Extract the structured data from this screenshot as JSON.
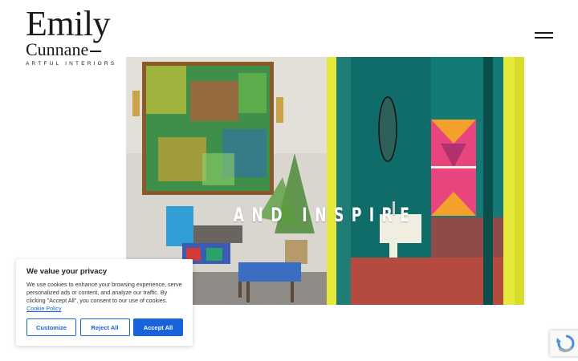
{
  "logo": {
    "line1": "Emily",
    "line2": "Cunnane",
    "tagline": "ARTFUL INTERIORS"
  },
  "menu": {
    "icon": "hamburger-menu-icon"
  },
  "hero": {
    "overlay_text": "AND INSPIRE"
  },
  "cookie_banner": {
    "title": "We value your privacy",
    "body": "We use cookies to enhance your browsing experience, serve personalized ads or content, and analyze our traffic. By clicking \"Accept All\", you consent to our use of cookies.",
    "policy_link": "Cookie Policy",
    "buttons": {
      "customize": "Customize",
      "reject": "Reject All",
      "accept": "Accept All"
    },
    "accent": "#1863dc"
  },
  "recaptcha": {
    "icon": "recaptcha-icon"
  }
}
